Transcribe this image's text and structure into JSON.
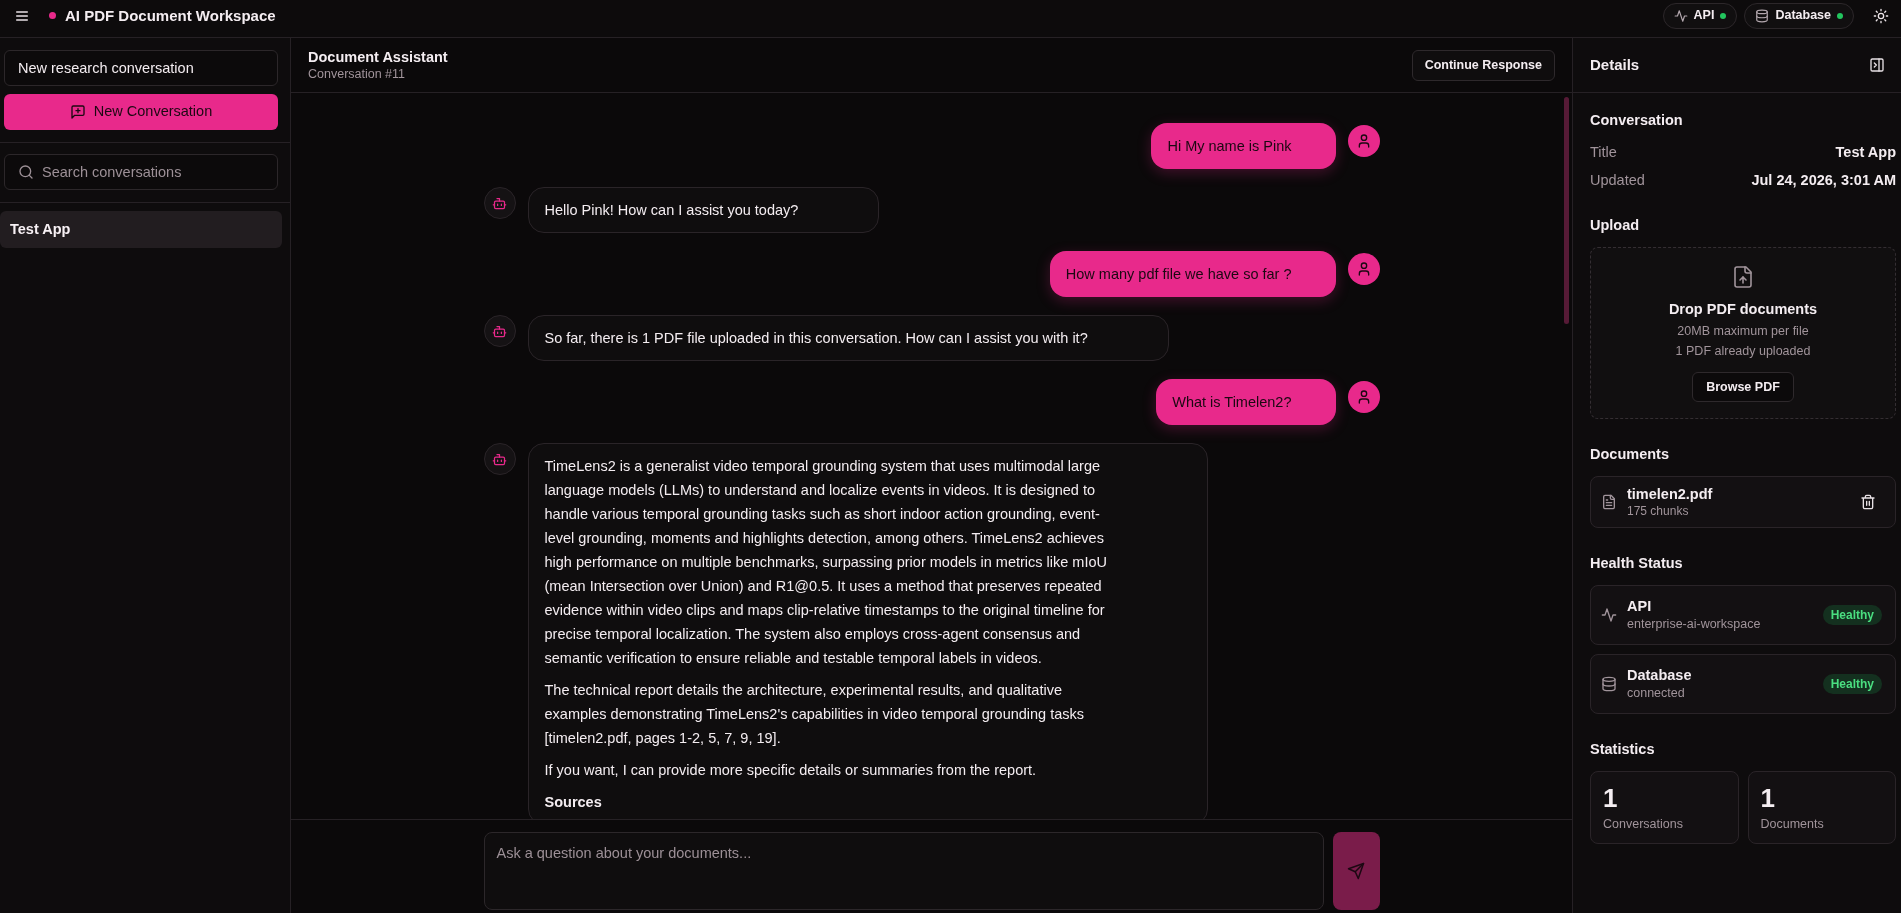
{
  "top_bar": {
    "title": "AI PDF Document Workspace",
    "services": [
      {
        "kind": "api",
        "label": "API",
        "online": true
      },
      {
        "kind": "database",
        "label": "Database",
        "online": true
      }
    ]
  },
  "sidebar": {
    "title_field": {
      "value": "New research conversation"
    },
    "new_button": "New Conversation",
    "search": {
      "placeholder": "Search conversations"
    },
    "conversations": [
      {
        "title": "Test App",
        "selected": true
      }
    ]
  },
  "chat": {
    "title": "Document Assistant",
    "subtitle": "Conversation #11",
    "continue_button": "Continue Response",
    "messages": [
      {
        "kind": "user",
        "blocks": [
          {
            "kind": "paragraph",
            "text": "Hi My name is Pink"
          }
        ]
      },
      {
        "kind": "assistant",
        "blocks": [
          {
            "kind": "paragraph",
            "text": "Hello Pink! How can I assist you today?"
          }
        ]
      },
      {
        "kind": "user",
        "blocks": [
          {
            "kind": "paragraph",
            "text": "How many pdf file we have so far ?"
          }
        ]
      },
      {
        "kind": "assistant",
        "blocks": [
          {
            "kind": "paragraph",
            "text": "So far, there is 1 PDF file uploaded in this conversation. How can I assist you with it?"
          }
        ]
      },
      {
        "kind": "user",
        "blocks": [
          {
            "kind": "paragraph",
            "text": "What is Timelen2?"
          }
        ]
      },
      {
        "kind": "assistant",
        "blocks": [
          {
            "kind": "paragraph",
            "text": "TimeLens2 is a generalist video temporal grounding system that uses multimodal large language models (LLMs) to understand and localize events in videos. It is designed to handle various temporal grounding tasks such as short indoor action grounding, event-level grounding, moments and highlights detection, among others. TimeLens2 achieves high performance on multiple benchmarks, surpassing prior models in metrics like mIoU (mean Intersection over Union) and R1@0.5. It uses a method that preserves repeated evidence within video clips and maps clip-relative timestamps to the original timeline for precise temporal localization. The system also employs cross-agent consensus and semantic verification to ensure reliable and testable temporal labels in videos."
          },
          {
            "kind": "paragraph",
            "text": "The technical report details the architecture, experimental results, and qualitative examples demonstrating TimeLens2's capabilities in video temporal grounding tasks [timelen2.pdf, pages 1-2, 5, 7, 9, 19]."
          },
          {
            "kind": "paragraph",
            "text": "If you want, I can provide more specific details or summaries from the report."
          },
          {
            "kind": "heading",
            "text": "Sources"
          }
        ]
      }
    ],
    "composer": {
      "placeholder": "Ask a question about your documents...",
      "send_disabled": true
    }
  },
  "details": {
    "title": "Details",
    "conversation": {
      "heading": "Conversation",
      "rows": [
        {
          "label": "Title",
          "value": "Test App"
        },
        {
          "label": "Updated",
          "value": "Jul 24, 2026, 3:01 AM"
        }
      ]
    },
    "upload": {
      "heading": "Upload",
      "title": "Drop PDF documents",
      "notes": [
        "20MB maximum per file",
        "1 PDF already uploaded"
      ],
      "button": "Browse PDF"
    },
    "documents": {
      "heading": "Documents",
      "items": [
        {
          "name": "timelen2.pdf",
          "meta": "175 chunks"
        }
      ]
    },
    "health": {
      "heading": "Health Status",
      "items": [
        {
          "kind": "api",
          "name": "API",
          "detail": "enterprise-ai-workspace",
          "status": "Healthy",
          "healthy": true
        },
        {
          "kind": "database",
          "name": "Database",
          "detail": "connected",
          "status": "Healthy",
          "healthy": true
        }
      ]
    },
    "statistics": {
      "heading": "Statistics",
      "items": [
        {
          "value": "1",
          "label": "Conversations"
        },
        {
          "value": "1",
          "label": "Documents"
        }
      ]
    }
  }
}
